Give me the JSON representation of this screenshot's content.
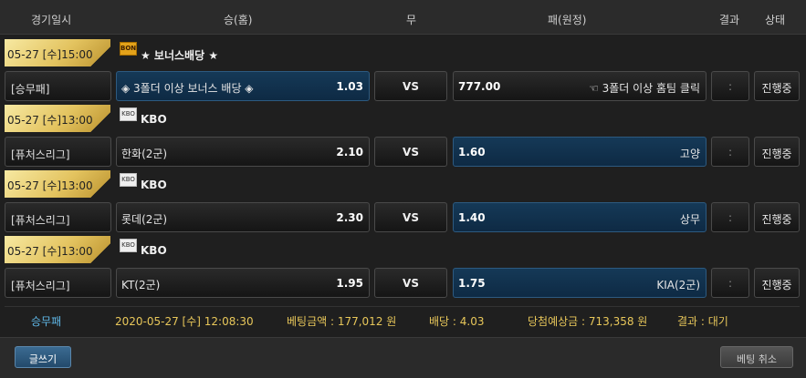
{
  "header": {
    "date_col": "경기일시",
    "home_col": "승(홈)",
    "draw_col": "무",
    "away_col": "패(원정)",
    "result_col": "결과",
    "status_col": "상태"
  },
  "games": [
    {
      "date": "05-27 [수]15:00",
      "league_icon": "bonus-icon",
      "league": "★ 보너스배당 ★",
      "bet_type": "[승무패]",
      "home_name": "◈ 3폴더 이상 보너스 배당 ◈",
      "home_odds": "1.03",
      "draw": "VS",
      "away_odds": "777.00",
      "away_name": "☜ 3폴더 이상 홈팀 클릭",
      "result": ":",
      "status": "진행중",
      "selected": "home"
    },
    {
      "date": "05-27 [수]13:00",
      "league_icon": "kbo-icon",
      "league": "KBO",
      "bet_type": "[퓨처스리그]",
      "home_name": "한화(2군)",
      "home_odds": "2.10",
      "draw": "VS",
      "away_odds": "1.60",
      "away_name": "고양",
      "result": ":",
      "status": "진행중",
      "selected": "away"
    },
    {
      "date": "05-27 [수]13:00",
      "league_icon": "kbo-icon",
      "league": "KBO",
      "bet_type": "[퓨처스리그]",
      "home_name": "롯데(2군)",
      "home_odds": "2.30",
      "draw": "VS",
      "away_odds": "1.40",
      "away_name": "상무",
      "result": ":",
      "status": "진행중",
      "selected": "away"
    },
    {
      "date": "05-27 [수]13:00",
      "league_icon": "kbo-icon",
      "league": "KBO",
      "bet_type": "[퓨처스리그]",
      "home_name": "KT(2군)",
      "home_odds": "1.95",
      "draw": "VS",
      "away_odds": "1.75",
      "away_name": "KIA(2군)",
      "result": ":",
      "status": "진행중",
      "selected": "away"
    }
  ],
  "summary": {
    "type": "승무패",
    "datetime": "2020-05-27 [수] 12:08:30",
    "bet_amount": "베팅금액 : 177,012 원",
    "odds": "배당 : 4.03",
    "expected_win": "당첨예상금 : 713,358 원",
    "result": "결과 : 대기"
  },
  "buttons": {
    "write": "글쓰기",
    "cancel_bet": "베팅 취소"
  },
  "colors": {
    "selected_bg": "#153957",
    "gold_badge": "#e3c35f",
    "summary_type": "#5fb8e8",
    "summary_label": "#e8c75a"
  }
}
